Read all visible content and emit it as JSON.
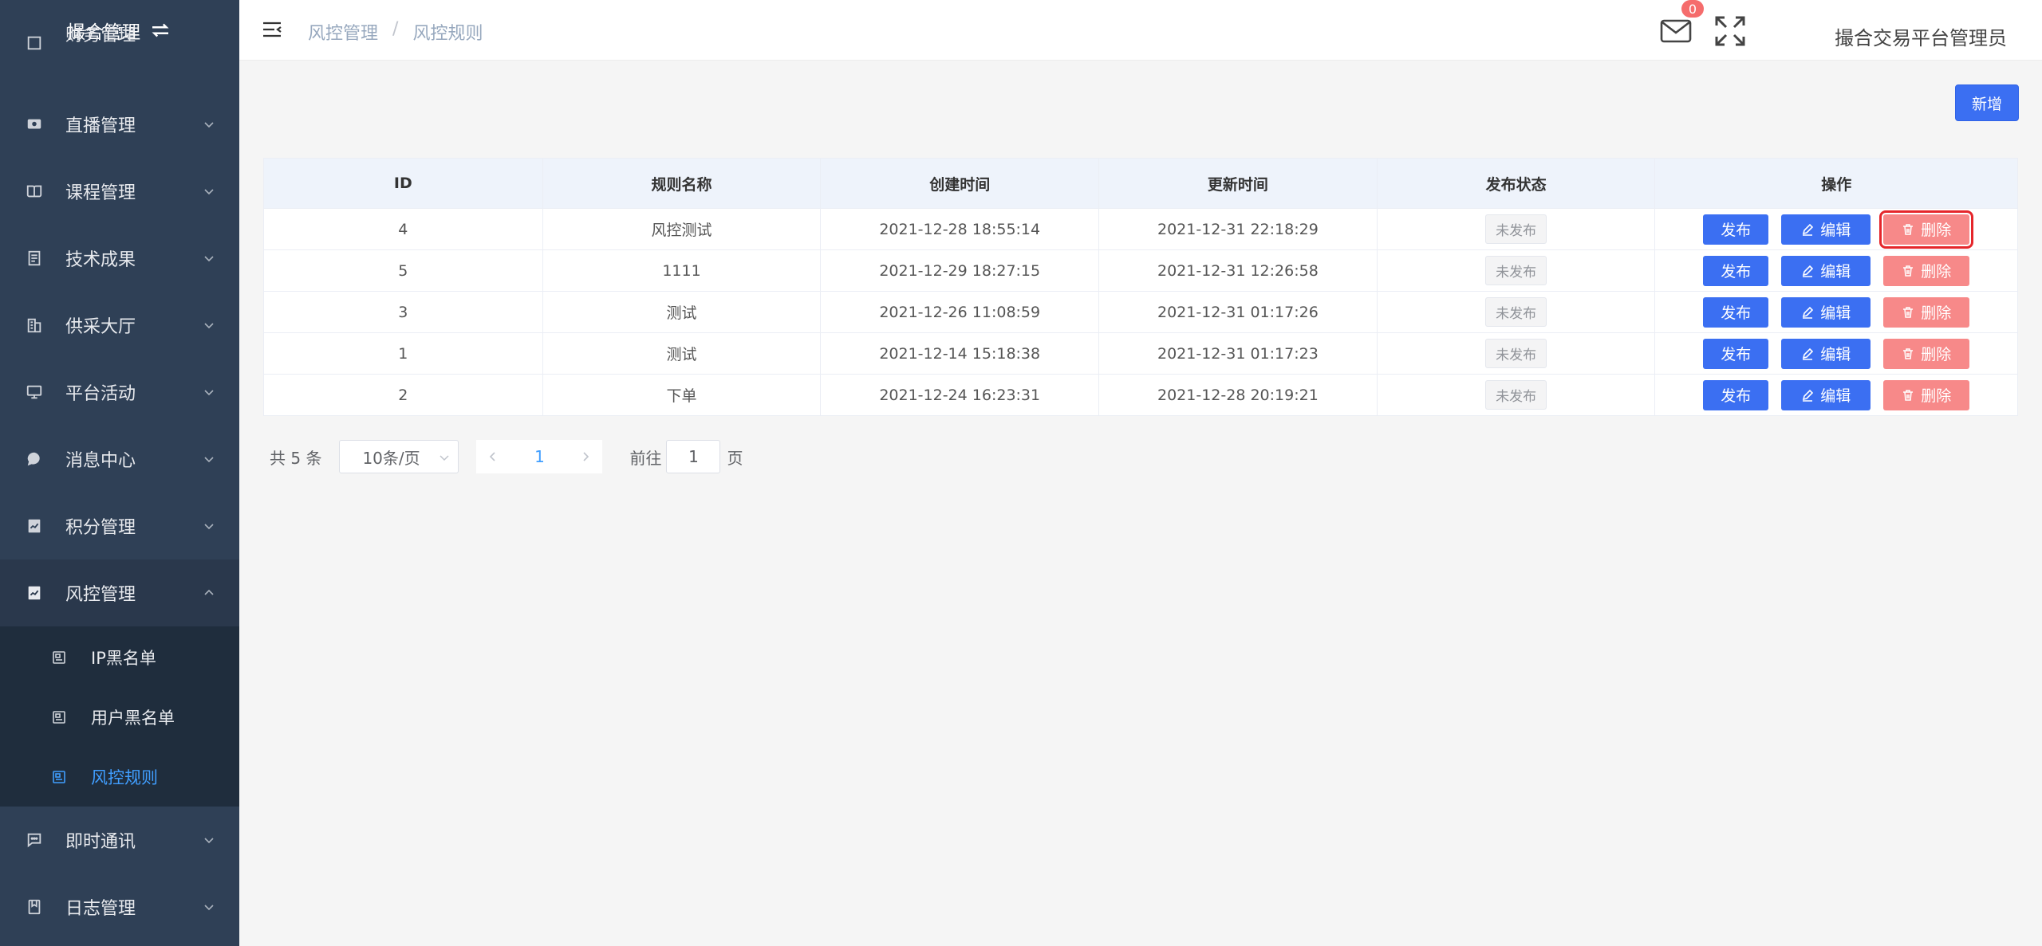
{
  "sidebar": {
    "logo_text": "撮合管理",
    "partial_item": "财务管理",
    "items": [
      {
        "label": "直播管理",
        "icon": "tv-icon"
      },
      {
        "label": "课程管理",
        "icon": "book-icon"
      },
      {
        "label": "技术成果",
        "icon": "document-icon"
      },
      {
        "label": "供采大厅",
        "icon": "building-icon"
      },
      {
        "label": "平台活动",
        "icon": "monitor-icon"
      },
      {
        "label": "消息中心",
        "icon": "chat-bubble-icon"
      },
      {
        "label": "积分管理",
        "icon": "chart-icon"
      },
      {
        "label": "风控管理",
        "icon": "chart-icon"
      },
      {
        "label": "即时通讯",
        "icon": "message-icon"
      },
      {
        "label": "日志管理",
        "icon": "log-icon"
      }
    ],
    "submenu": [
      {
        "label": "IP黑名单",
        "icon": "list-icon"
      },
      {
        "label": "用户黑名单",
        "icon": "list-icon"
      },
      {
        "label": "风控规则",
        "icon": "list-icon",
        "active": true
      }
    ]
  },
  "header": {
    "breadcrumb": [
      "风控管理",
      "风控规则"
    ],
    "breadcrumb_sep": "/",
    "mail_badge": "0",
    "username": "撮合交易平台管理员"
  },
  "toolbar": {
    "add_label": "新增"
  },
  "table": {
    "columns": [
      "ID",
      "规则名称",
      "创建时间",
      "更新时间",
      "发布状态",
      "操作"
    ],
    "rows": [
      {
        "id": "4",
        "name": "风控测试",
        "created": "2021-12-28 18:55:14",
        "updated": "2021-12-31 22:18:29",
        "status": "未发布"
      },
      {
        "id": "5",
        "name": "1111",
        "created": "2021-12-29 18:27:15",
        "updated": "2021-12-31 12:26:58",
        "status": "未发布"
      },
      {
        "id": "3",
        "name": "测试",
        "created": "2021-12-26 11:08:59",
        "updated": "2021-12-31 01:17:26",
        "status": "未发布"
      },
      {
        "id": "1",
        "name": "测试",
        "created": "2021-12-14 15:18:38",
        "updated": "2021-12-31 01:17:23",
        "status": "未发布"
      },
      {
        "id": "2",
        "name": "下单",
        "created": "2021-12-24 16:23:31",
        "updated": "2021-12-28 20:19:21",
        "status": "未发布"
      }
    ],
    "actions": {
      "publish": "发布",
      "edit": "编辑",
      "delete": "删除"
    }
  },
  "pagination": {
    "total_text": "共 5 条",
    "page_size": "10条/页",
    "current_page": "1",
    "goto_label": "前往",
    "goto_value": "1",
    "page_suffix": "页"
  },
  "colors": {
    "sidebar_bg": "#2f4056",
    "submenu_bg": "#1f2d3d",
    "active": "#409eff",
    "primary_button": "#3b6ff2",
    "danger_button": "#f78989",
    "badge": "#f56c6c"
  }
}
